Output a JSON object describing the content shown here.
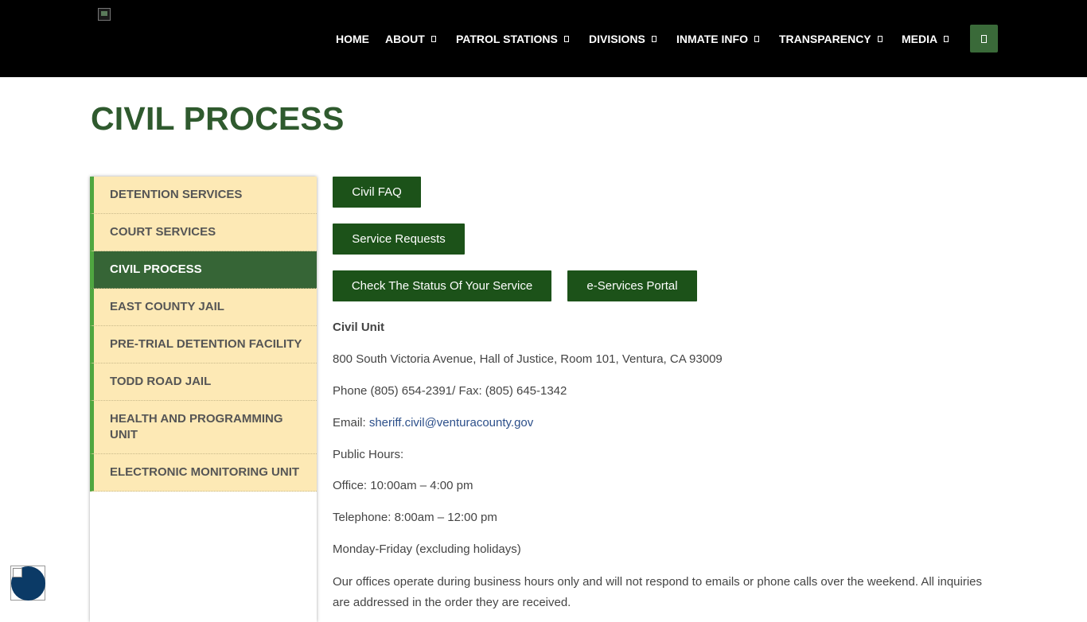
{
  "header": {
    "nav": [
      {
        "label": "HOME",
        "has_dropdown": false
      },
      {
        "label": "ABOUT",
        "has_dropdown": true
      },
      {
        "label": "PATROL STATIONS",
        "has_dropdown": true
      },
      {
        "label": "DIVISIONS",
        "has_dropdown": true
      },
      {
        "label": "INMATE INFO",
        "has_dropdown": true
      },
      {
        "label": "TRANSPARENCY",
        "has_dropdown": true
      },
      {
        "label": "MEDIA",
        "has_dropdown": true
      }
    ],
    "search_icon": "search-icon"
  },
  "page": {
    "title": "CIVIL PROCESS"
  },
  "sidebar": {
    "items": [
      {
        "label": "DETENTION SERVICES",
        "active": false
      },
      {
        "label": "COURT SERVICES",
        "active": false
      },
      {
        "label": "CIVIL PROCESS",
        "active": true
      },
      {
        "label": "EAST COUNTY JAIL",
        "active": false
      },
      {
        "label": "PRE-TRIAL DETENTION FACILITY",
        "active": false
      },
      {
        "label": "TODD ROAD JAIL",
        "active": false
      },
      {
        "label": "HEALTH AND PROGRAMMING UNIT",
        "active": false
      },
      {
        "label": "ELECTRONIC MONITORING UNIT",
        "active": false
      }
    ]
  },
  "buttons": {
    "civil_faq": "Civil FAQ",
    "service_requests": "Service Requests",
    "check_status": "Check The Status Of Your Service",
    "eservices": "e-Services Portal"
  },
  "content": {
    "unit_title": "Civil Unit",
    "address": "800 South Victoria Avenue, Hall of Justice, Room 101, Ventura, CA 93009",
    "phone": "Phone (805) 654-2391/ Fax: (805) 645-1342",
    "email_label": "Email: ",
    "email": "sheriff.civil@venturacounty.gov",
    "public_hours": "Public Hours:",
    "office_hours": "Office: 10:00am – 4:00 pm",
    "telephone_hours": "Telephone: 8:00am – 12:00 pm",
    "days": "Monday-Friday (excluding holidays)",
    "notice": "Our offices operate during business hours only and will not respond to emails or phone calls over the weekend. All inquiries are addressed in the order they are received."
  },
  "colors": {
    "header_bg": "#000000",
    "title_green": "#2f5a2e",
    "button_green": "#1c5219",
    "sidebar_bg": "#fde9b5",
    "sidebar_active": "#366536",
    "sidebar_border": "#4fa640",
    "link": "#2c4f8a"
  },
  "accessibility_widget": {
    "icon": "accessibility-icon"
  }
}
